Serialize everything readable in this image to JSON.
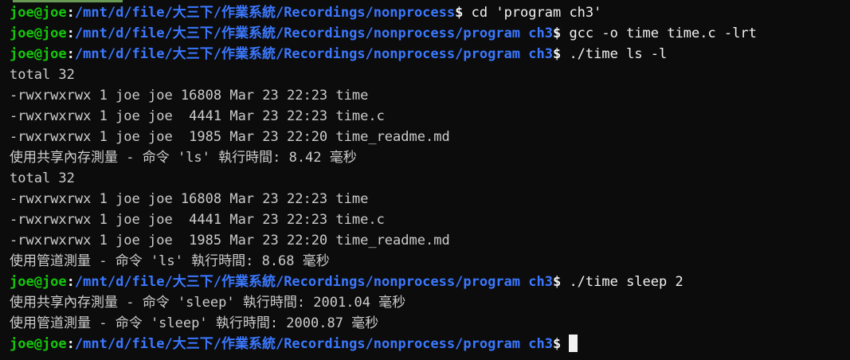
{
  "prompt": {
    "user": "joe@joe",
    "colon": ":",
    "path_base": "/mnt/d/file/大三下/作業系統/Recordings/nonprocess",
    "path_program": "/mnt/d/file/大三下/作業系統/Recordings/nonprocess/program ch3",
    "symbol": "$"
  },
  "commands": {
    "cd": " cd 'program ch3'",
    "gcc": " gcc -o time time.c -lrt",
    "run_ls": " ./time ls -l",
    "run_sleep": " ./time sleep 2",
    "current": " "
  },
  "output": {
    "ls_total_1": "total 32",
    "ls_row_1a": "-rwxrwxrwx 1 joe joe 16808 Mar 23 22:23 time",
    "ls_row_1b": "-rwxrwxrwx 1 joe joe  4441 Mar 23 22:23 time.c",
    "ls_row_1c": "-rwxrwxrwx 1 joe joe  1985 Mar 23 22:20 time_readme.md",
    "shm_ls": "使用共享內存測量 - 命令 'ls' 執行時間: 8.42 毫秒",
    "ls_total_2": "total 32",
    "ls_row_2a": "-rwxrwxrwx 1 joe joe 16808 Mar 23 22:23 time",
    "ls_row_2b": "-rwxrwxrwx 1 joe joe  4441 Mar 23 22:23 time.c",
    "ls_row_2c": "-rwxrwxrwx 1 joe joe  1985 Mar 23 22:20 time_readme.md",
    "pipe_ls": "使用管道測量 - 命令 'ls' 執行時間: 8.68 毫秒",
    "shm_sleep": "使用共享內存測量 - 命令 'sleep' 執行時間: 2001.04 毫秒",
    "pipe_sleep": "使用管道測量 - 命令 'sleep' 執行時間: 2000.87 毫秒"
  },
  "colors": {
    "background": "#0c0c0c",
    "user": "#16c60c",
    "path": "#3b78ff",
    "text": "#cccccc"
  }
}
